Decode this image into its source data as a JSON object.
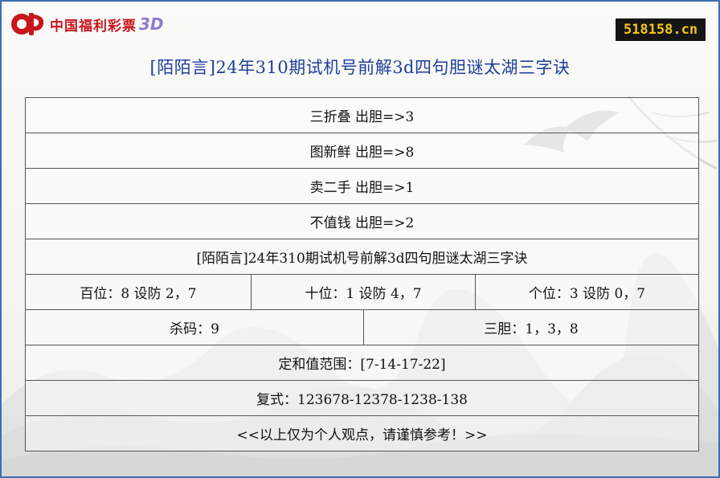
{
  "brand": {
    "logo_text": "中国福利彩票",
    "logo_suffix": "3D"
  },
  "site_badge": "518158.cn",
  "title": "[陌陌言]24年310期试机号前解3d四句胆谜太湖三字诀",
  "rows": {
    "r1": "三折叠 出胆=>3",
    "r2": "图新鲜 出胆=>8",
    "r3": "卖二手 出胆=>1",
    "r4": "不值钱 出胆=>2",
    "r5": "[陌陌言]24年310期试机号前解3d四句胆谜太湖三字诀",
    "hundreds": "百位：8 设防 2，7",
    "tens": "十位：1 设防 4，7",
    "units": "个位：3 设防 0，7",
    "kill": "杀码：9",
    "three_dan": "三胆：1，3，8",
    "sum_range": "定和值范围：[7-14-17-22]",
    "compound": "复式：123678-12378-1238-138",
    "footer": "<<以上仅为个人观点，请谨慎参考！>>"
  },
  "colors": {
    "frame_border": "#3a6fb0",
    "title": "#1f3f9a",
    "logo_red": "#c8161d",
    "logo_3d": "#8f7ad0",
    "badge_bg": "#151515",
    "badge_text": "#f2c418"
  }
}
